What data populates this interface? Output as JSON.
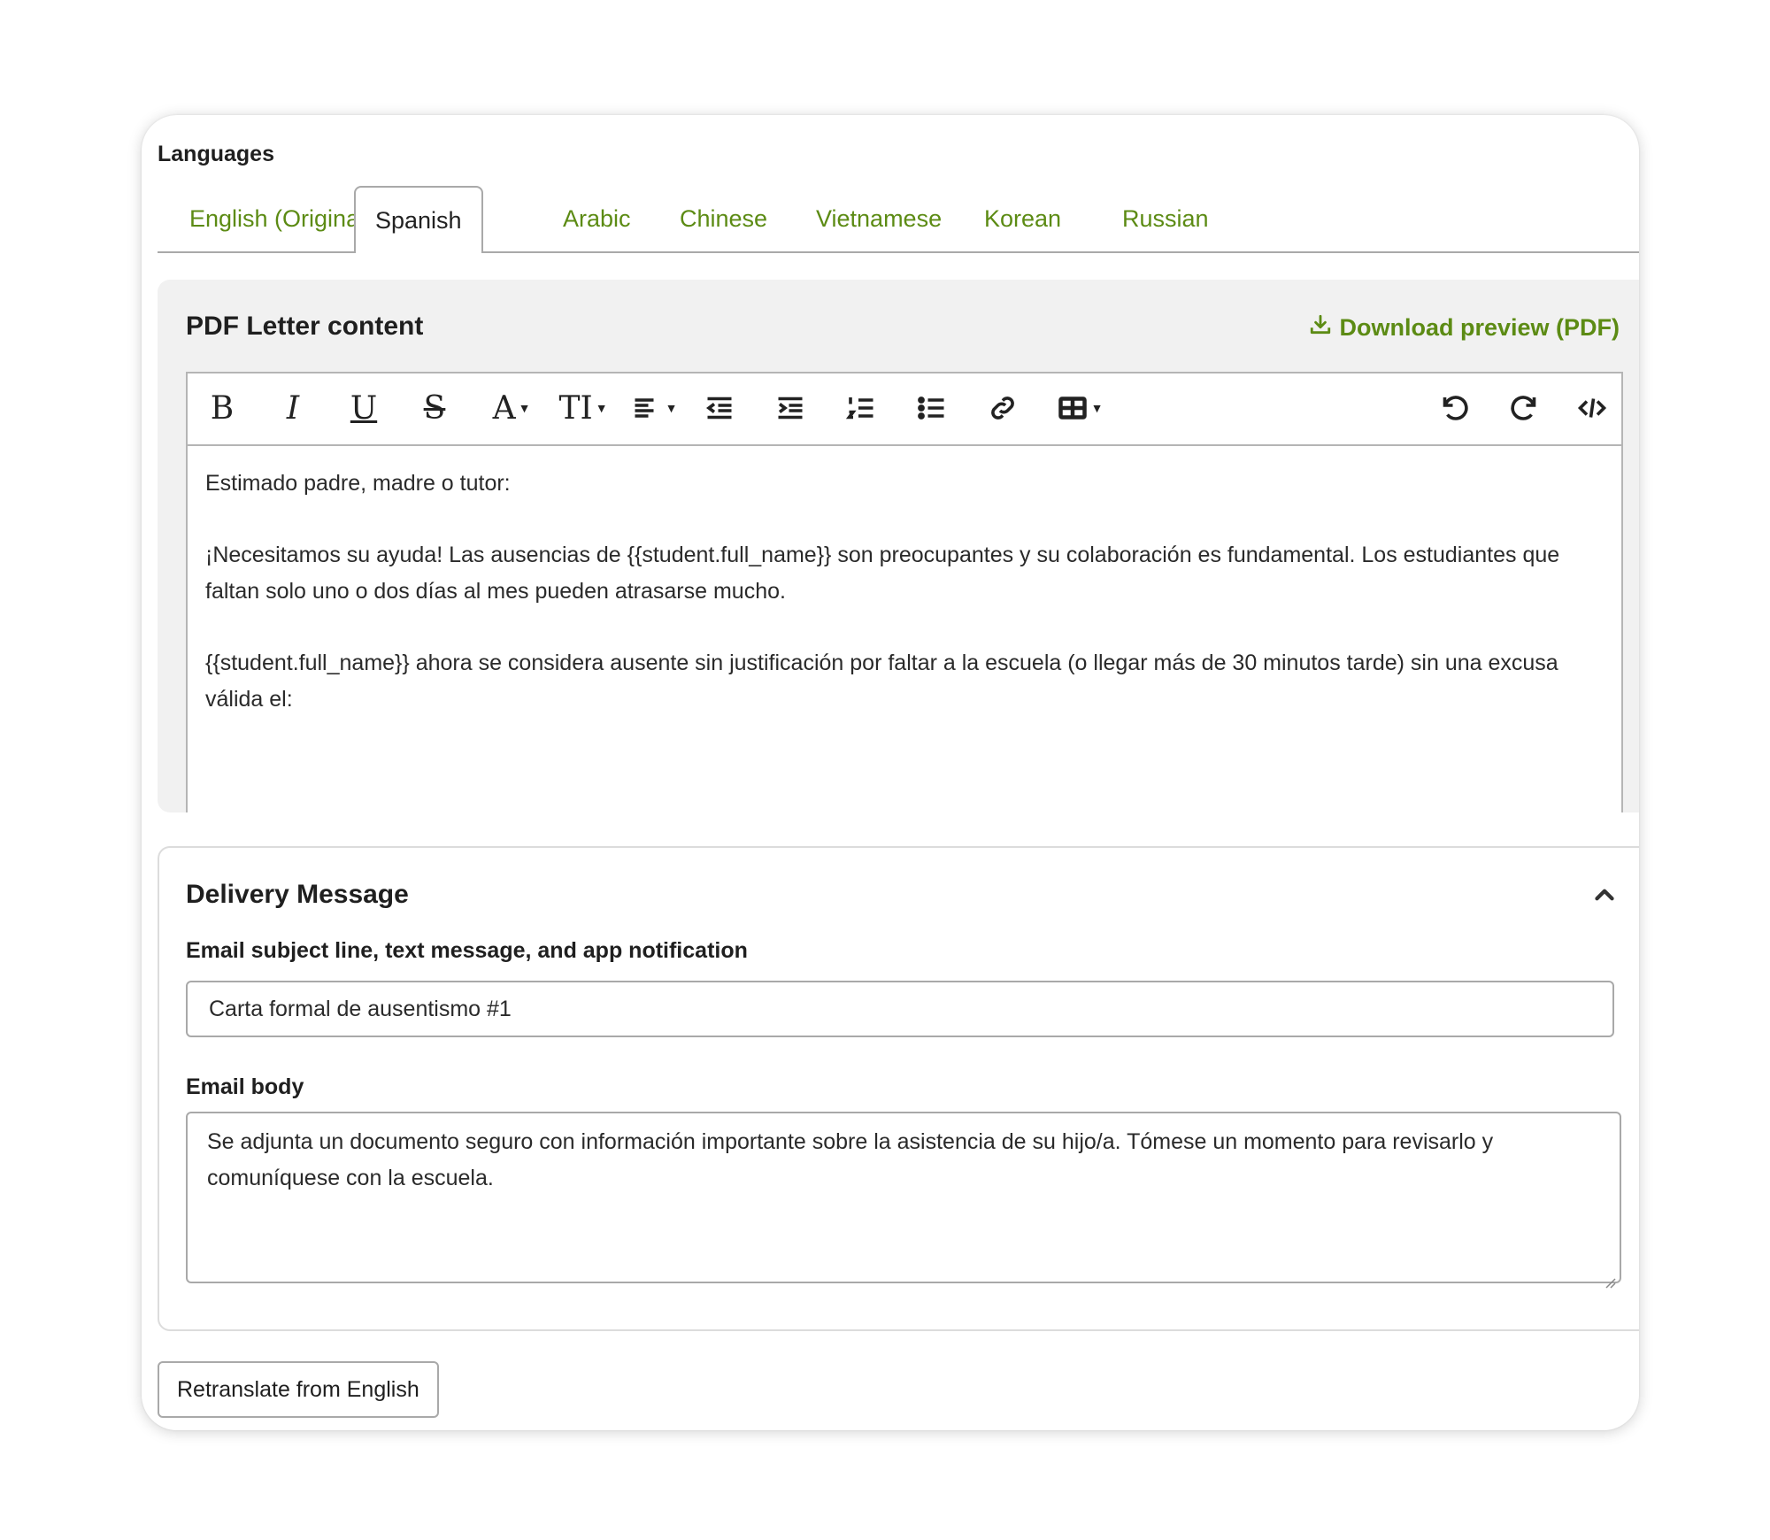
{
  "languages": {
    "label": "Languages",
    "tabs": [
      {
        "label": "English (Original)"
      },
      {
        "label": "Spanish"
      },
      {
        "label": "Arabic"
      },
      {
        "label": "Chinese"
      },
      {
        "label": "Vietnamese"
      },
      {
        "label": "Korean"
      },
      {
        "label": "Russian"
      }
    ],
    "active_tab": "Spanish"
  },
  "pdf": {
    "title": "PDF Letter content",
    "download_label": "Download preview (PDF)",
    "toolbar": {
      "bold": "B",
      "italic": "I",
      "underline": "U",
      "strike": "S",
      "font_color": "A",
      "font_size": "TI",
      "icons": [
        "bold-icon",
        "italic-icon",
        "underline-icon",
        "strikethrough-icon",
        "font-color-icon",
        "font-size-icon",
        "align-icon",
        "outdent-icon",
        "indent-icon",
        "ordered-list-icon",
        "bullet-list-icon",
        "link-icon",
        "table-icon",
        "undo-icon",
        "redo-icon",
        "code-view-icon"
      ]
    },
    "body": {
      "p1": "Estimado padre, madre o tutor:",
      "p2": "¡Necesitamos su ayuda! Las ausencias de {{student.full_name}} son preocupantes y su colaboración es fundamental. Los estudiantes que faltan solo uno o dos días al mes pueden atrasarse mucho.",
      "p3": "{{student.full_name}} ahora se considera ausente sin justificación por faltar a la escuela (o llegar más de 30 minutos tarde) sin una excusa válida el:"
    }
  },
  "delivery": {
    "title": "Delivery Message",
    "subject_label": "Email subject line, text message, and app notification",
    "subject_value": "Carta formal de ausentismo #1",
    "body_label": "Email body",
    "body_value": "Se adjunta un documento seguro con información importante sobre la asistencia de su hijo/a. Tómese un momento para revisarlo y comuníquese con la escuela."
  },
  "actions": {
    "retranslate_label": "Retranslate from English"
  },
  "colors": {
    "accent": "#5c8b14",
    "panel_bg": "#f1f1f1",
    "border": "#a9a9a9"
  }
}
